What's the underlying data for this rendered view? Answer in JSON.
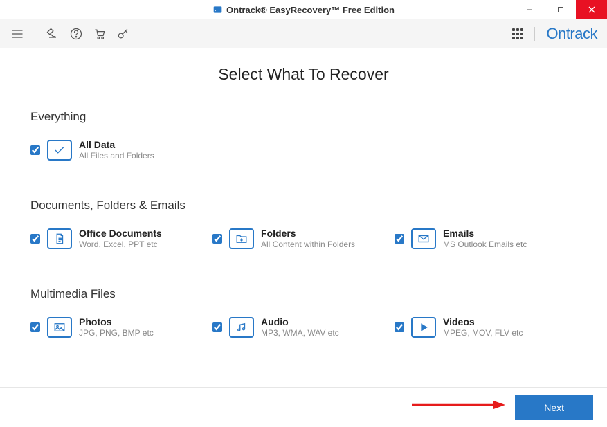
{
  "titlebar": {
    "title": "Ontrack® EasyRecovery™ Free Edition"
  },
  "toolbar": {
    "brand": "Ontrack"
  },
  "main": {
    "title": "Select What To Recover",
    "sections": [
      {
        "heading": "Everything",
        "options": [
          {
            "title": "All Data",
            "sub": "All Files and Folders"
          }
        ]
      },
      {
        "heading": "Documents, Folders & Emails",
        "options": [
          {
            "title": "Office Documents",
            "sub": "Word, Excel, PPT etc"
          },
          {
            "title": "Folders",
            "sub": "All Content within Folders"
          },
          {
            "title": "Emails",
            "sub": "MS Outlook Emails etc"
          }
        ]
      },
      {
        "heading": "Multimedia Files",
        "options": [
          {
            "title": "Photos",
            "sub": "JPG, PNG, BMP etc"
          },
          {
            "title": "Audio",
            "sub": "MP3, WMA, WAV etc"
          },
          {
            "title": "Videos",
            "sub": "MPEG, MOV, FLV etc"
          }
        ]
      }
    ]
  },
  "footer": {
    "next": "Next"
  }
}
